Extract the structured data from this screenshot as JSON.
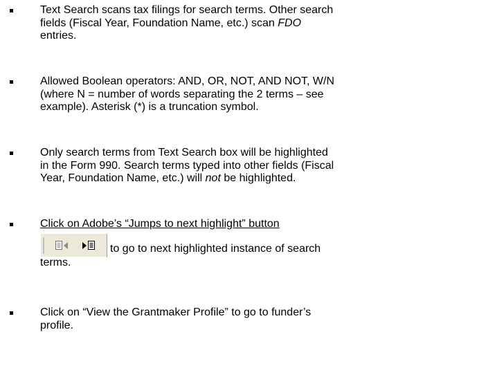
{
  "bullets": [
    {
      "lines": [
        "Text Search scans tax filings for search terms. Other search",
        "fields (Fiscal Year, Foundation Name, etc.) scan ",
        "FDO",
        "entries."
      ]
    },
    {
      "lines": [
        "Allowed Boolean operators: AND, OR, NOT, AND NOT, W/N",
        "(where N = number of words separating the 2 terms – see",
        "example). Asterisk (*) is a truncation symbol."
      ]
    },
    {
      "lines": [
        "Only search terms from Text Search box will be highlighted",
        "in the Form 990. Search terms typed into other fields (Fiscal",
        "Year, Foundation Name, etc.) will ",
        "not",
        " be highlighted."
      ]
    },
    {
      "lines": [
        "Click on Adobe’s “Jumps to next highlight” button",
        "to go to next highlighted instance of search",
        "terms."
      ]
    },
    {
      "lines": [
        "Click on “View the Grantmaker Profile” to go to funder’s",
        "profile."
      ]
    }
  ],
  "toolbar": {
    "buttons": [
      {
        "icon": "previous-highlight-icon"
      },
      {
        "icon": "next-highlight-icon"
      }
    ]
  }
}
